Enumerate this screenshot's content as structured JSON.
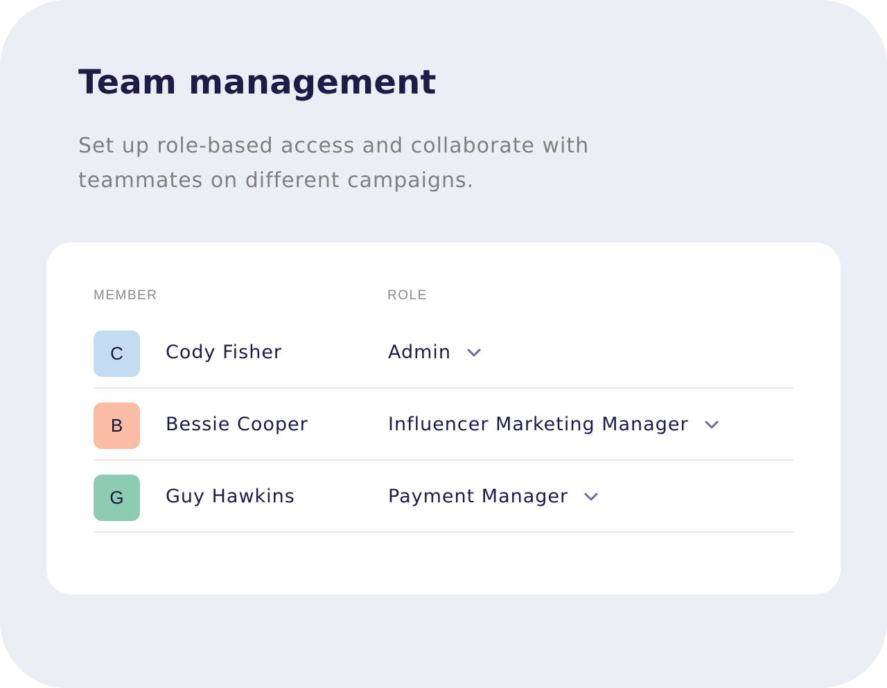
{
  "title": "Team management",
  "subtitle_lines": [
    "Set up role-based access and collaborate with",
    "teammates on different campaigns."
  ],
  "table": {
    "headers": {
      "member": "MEMBER",
      "role": "ROLE"
    },
    "rows": [
      {
        "initial": "C",
        "name": "Cody Fisher",
        "role": "Admin",
        "avatar_color": "#c4dcf1"
      },
      {
        "initial": "B",
        "name": "Bessie Cooper",
        "role": "Influencer Marketing Manager",
        "avatar_color": "#fbbca5"
      },
      {
        "initial": "G",
        "name": "Guy Hawkins",
        "role": "Payment Manager",
        "avatar_color": "#8dcbb2"
      }
    ]
  },
  "colors": {
    "background": "#ebeef5",
    "card": "#ffffff",
    "heading": "#1c1c45",
    "muted": "#7f7f7f",
    "chevron": "#6d6a9c",
    "divider": "#e6e8ec"
  },
  "icons": {
    "role_dropdown": "chevron-down-icon"
  }
}
